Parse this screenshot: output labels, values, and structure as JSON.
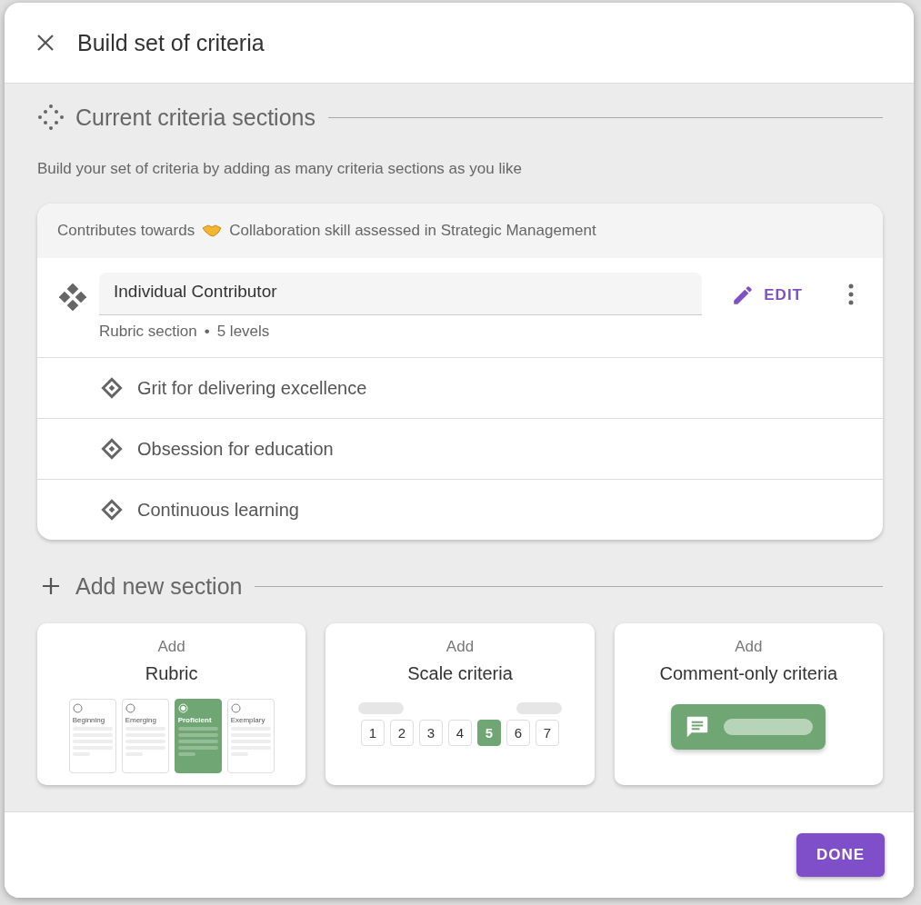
{
  "dialog": {
    "title": "Build set of criteria"
  },
  "current": {
    "heading": "Current criteria sections",
    "description": "Build your set of criteria by adding as many criteria sections as you like",
    "card": {
      "contributes_label": "Contributes towards",
      "skill": "Collaboration skill assessed in Strategic Management",
      "section_name": "Individual Contributor",
      "section_type": "Rubric section",
      "separator": "•",
      "levels": "5 levels",
      "edit_label": "EDIT",
      "criteria": [
        {
          "label": "Grit for delivering excellence"
        },
        {
          "label": "Obsession for education"
        },
        {
          "label": "Continuous learning"
        }
      ]
    }
  },
  "add": {
    "heading": "Add new section",
    "options": [
      {
        "kind": "rubric",
        "prefix": "Add",
        "title": "Rubric",
        "levels": [
          {
            "label": "Beginning",
            "selected": false
          },
          {
            "label": "Emerging",
            "selected": false
          },
          {
            "label": "Proficient",
            "selected": true
          },
          {
            "label": "Exemplary",
            "selected": false
          }
        ]
      },
      {
        "kind": "scale",
        "prefix": "Add",
        "title": "Scale criteria",
        "numbers": [
          {
            "label": "1",
            "selected": false
          },
          {
            "label": "2",
            "selected": false
          },
          {
            "label": "3",
            "selected": false
          },
          {
            "label": "4",
            "selected": false
          },
          {
            "label": "5",
            "selected": true
          },
          {
            "label": "6",
            "selected": false
          },
          {
            "label": "7",
            "selected": false
          }
        ]
      },
      {
        "kind": "comment",
        "prefix": "Add",
        "title": "Comment-only criteria"
      }
    ]
  },
  "footer": {
    "done_label": "DONE"
  }
}
